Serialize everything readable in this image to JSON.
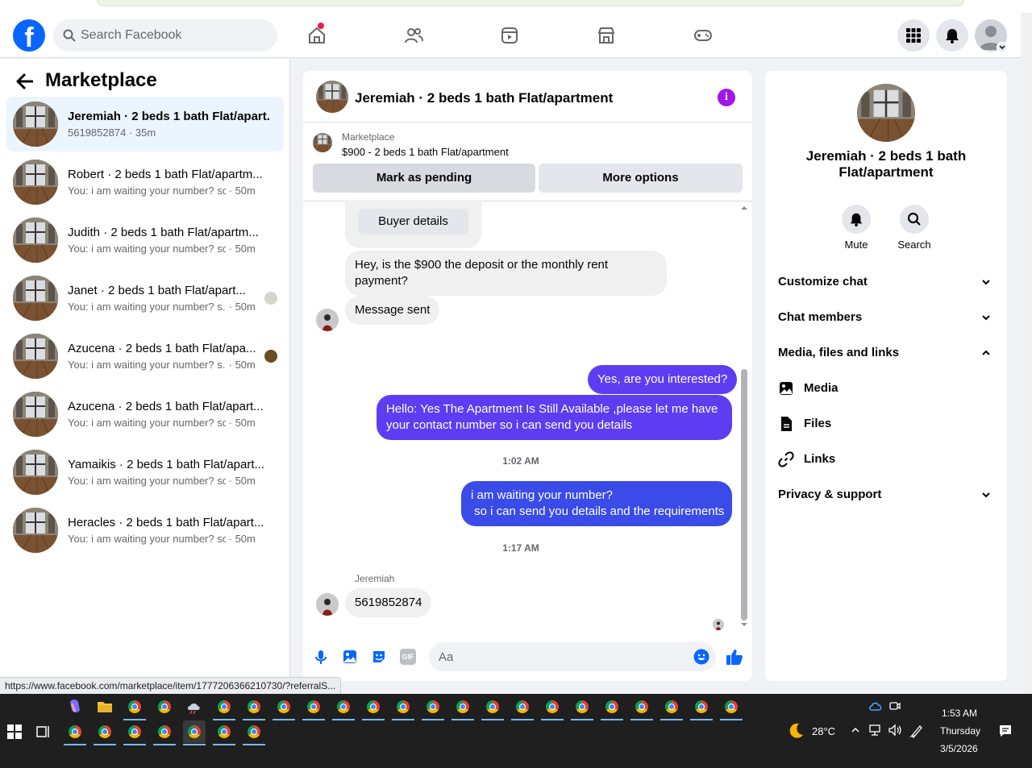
{
  "header": {
    "search_placeholder": "Search Facebook",
    "logo_letter": "f"
  },
  "sidebar": {
    "title": "Marketplace",
    "conversations": [
      {
        "name": "Jeremiah · 2 beds 1 bath Flat/apart...",
        "preview": "5619852874",
        "time": "35m"
      },
      {
        "name": "Robert · 2 beds 1 bath Flat/apartm...",
        "preview": "You: i am waiting your number? so i ...",
        "time": "50m"
      },
      {
        "name": "Judith · 2 beds 1 bath Flat/apartm...",
        "preview": "You: i am waiting your number? so i ...",
        "time": "50m"
      },
      {
        "name": "Janet · 2 beds 1 bath Flat/apart...",
        "preview": "You: i am waiting your number? s...",
        "time": "50m"
      },
      {
        "name": "Azucena · 2 beds 1 bath Flat/apa...",
        "preview": "You: i am waiting your number? s...",
        "time": "50m"
      },
      {
        "name": "Azucena · 2 beds 1 bath Flat/apart...",
        "preview": "You: i am waiting your number? so i ...",
        "time": "50m"
      },
      {
        "name": "Yamaikis · 2 beds 1 bath Flat/apart...",
        "preview": "You: i am waiting your number? so i ...",
        "time": "50m"
      },
      {
        "name": "Heracles · 2 beds 1 bath Flat/apart...",
        "preview": "You: i am waiting your number? so i ...",
        "time": "50m"
      }
    ]
  },
  "chat": {
    "title": "Jeremiah · 2 beds 1 bath Flat/apartment",
    "listing_source": "Marketplace",
    "listing_desc": "$900 - 2 beds 1 bath Flat/apartment",
    "mark_pending": "Mark as pending",
    "more_options": "More options",
    "buyer_details": "Buyer details",
    "messages": {
      "m1": "Hey, is the $900 the deposit or the monthly rent payment?",
      "m2": "Message sent",
      "m3": "Yes, are you interested?",
      "m4": "Hello: Yes The Apartment Is Still Available ,please let me have your contact number so i can send you details",
      "ts1": "1:02 AM",
      "m5_line1": "i am waiting your number?",
      "m5_line2": " so i can send you details and the requirements",
      "ts2": "1:17 AM",
      "sender": "Jeremiah",
      "m6": "5619852874"
    },
    "composer_placeholder": "Aa",
    "gif_label": "GIF"
  },
  "info": {
    "name": "Jeremiah · 2 beds 1 bath Flat/apartment",
    "mute": "Mute",
    "search": "Search",
    "customize": "Customize chat",
    "members": "Chat members",
    "media_files": "Media, files and links",
    "media": "Media",
    "files": "Files",
    "links": "Links",
    "privacy": "Privacy & support"
  },
  "status_url": "https://www.facebook.com/marketplace/item/1777206366210730/?referralS...",
  "taskbar": {
    "temperature": "28°C",
    "time": "1:53 AM",
    "day": "Thursday",
    "date": "3/5/2026"
  },
  "colors": {
    "brand": "#0866ff",
    "outgoing_bubble": "#5e3cf2",
    "outgoing_bubble_2": "#3a4be8",
    "active_conversation": "#ebf5ff"
  }
}
